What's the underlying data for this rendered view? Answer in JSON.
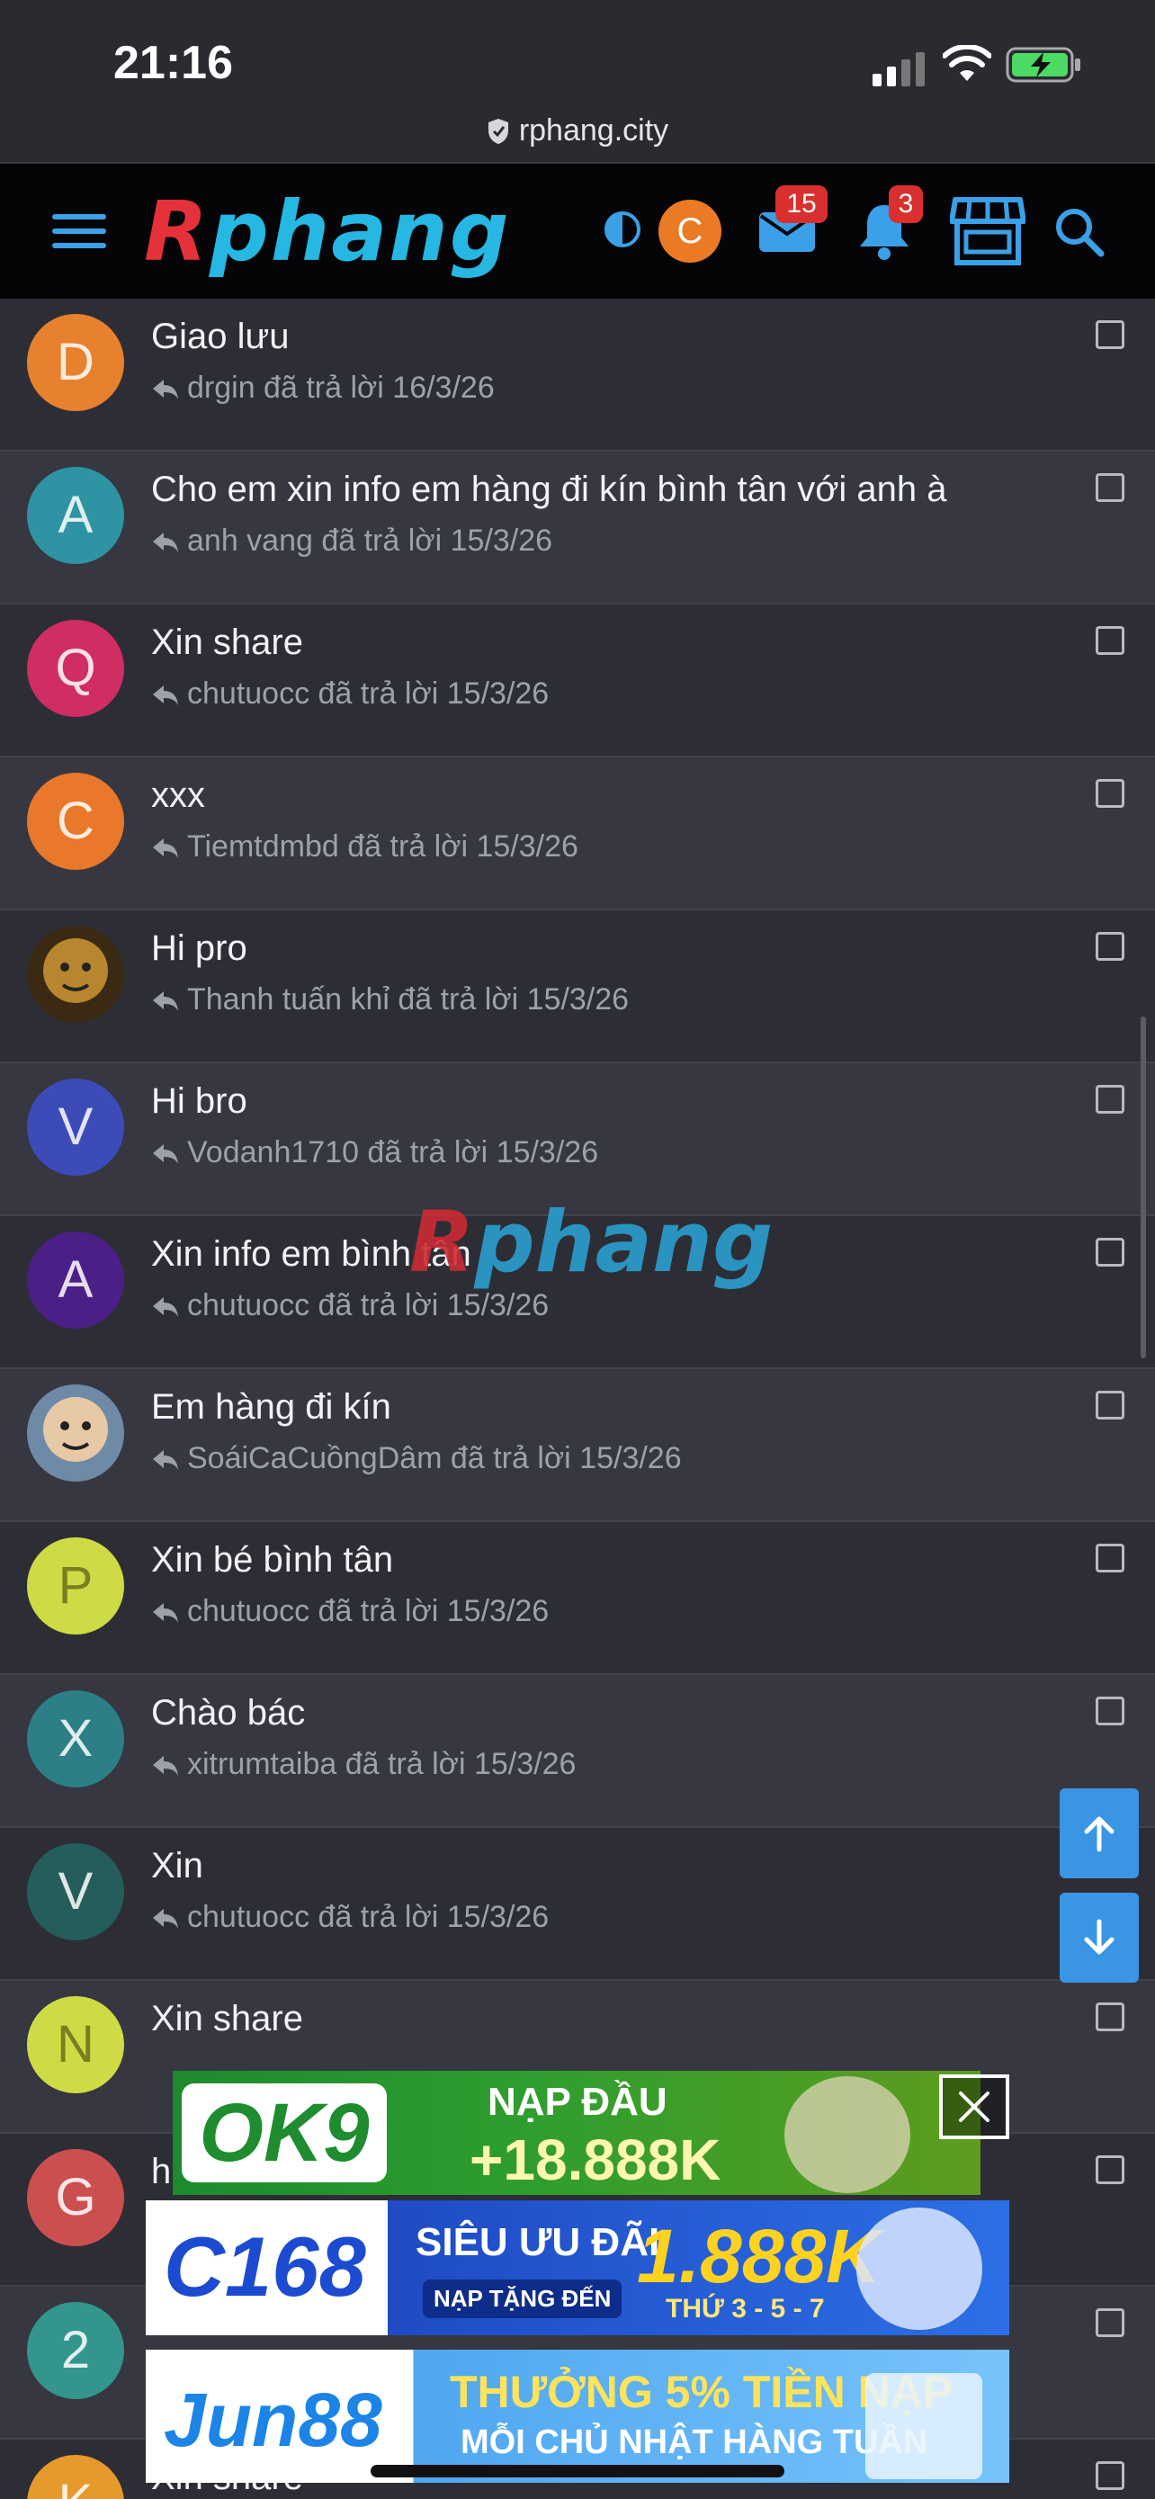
{
  "status_bar": {
    "time": "21:16"
  },
  "browser": {
    "url": "rphang.city"
  },
  "header": {
    "logo_r": "R",
    "logo_rest": "phang",
    "user_initial": "C",
    "mail_count": "15",
    "notification_count": "3"
  },
  "threads": [
    {
      "initial": "D",
      "avatar_color": "#e8812e",
      "title": "Giao lưu",
      "meta": "drgin đã trả lời 16/3/26"
    },
    {
      "initial": "A",
      "avatar_color": "#2e93a2",
      "title": "Cho em xin info em hàng đi kín bình tân với anh à",
      "meta": "anh vang đã trả lời 15/3/26"
    },
    {
      "initial": "Q",
      "avatar_color": "#cf2d63",
      "title": "Xin share",
      "meta": "chutuocc đã trả lời 15/3/26"
    },
    {
      "initial": "C",
      "avatar_color": "#e9782a",
      "title": "xxx",
      "meta": "Tiemtdmbd đã trả lời 15/3/26"
    },
    {
      "initial": "",
      "avatar_color": "#3a2a14",
      "avatar_icon": "lion-avatar-image",
      "title": "Hi pro",
      "meta": "Thanh tuấn khỉ đã trả lời 15/3/26"
    },
    {
      "initial": "V",
      "avatar_color": "#3d4bb8",
      "title": "Hi bro",
      "meta": "Vodanh1710 đã trả lời 15/3/26"
    },
    {
      "initial": "A",
      "avatar_color": "#4a1f86",
      "title": "Xin info em bình tân",
      "meta": "chutuocc đã trả lời 15/3/26"
    },
    {
      "initial": "",
      "avatar_color": "#6f8aa6",
      "avatar_icon": "cartoon-avatar-image",
      "title": "Em hàng đi kín",
      "meta": "SoáiCaCuồngDâm đã trả lời 15/3/26"
    },
    {
      "initial": "P",
      "avatar_color": "#cfdb45",
      "title": "Xin bé bình tân",
      "meta": "chutuocc đã trả lời 15/3/26"
    },
    {
      "initial": "X",
      "avatar_color": "#2c7f86",
      "title": "Chào bác",
      "meta": "xitrumtaiba đã trả lời 15/3/26"
    },
    {
      "initial": "V",
      "avatar_color": "#245d5a",
      "title": "Xin",
      "meta": "chutuocc đã trả lời 15/3/26"
    },
    {
      "initial": "N",
      "avatar_color": "#cfdb45",
      "title": "Xin share",
      "meta": ""
    },
    {
      "initial": "G",
      "avatar_color": "#cc4f4f",
      "title": "h",
      "meta": ""
    },
    {
      "initial": "2",
      "avatar_color": "#33958c",
      "title": "",
      "meta": ""
    },
    {
      "initial": "K",
      "avatar_color": "#e69a2c",
      "title": "Xin share",
      "meta": ""
    }
  ],
  "watermark": {
    "r": "R",
    "rest": "phang"
  },
  "ads": {
    "ok9": {
      "logo": "OK9",
      "line1": "NẠP ĐẦU",
      "line2": "+18.888K"
    },
    "c168": {
      "logo": "C168",
      "line1": "SIÊU ƯU ĐÃI",
      "line2": "NẠP TẶNG ĐẾN",
      "amount": "1.888K",
      "days": "THỨ 3 - 5 - 7"
    },
    "jun88": {
      "logo": "Jun88",
      "line1": "THƯỞNG 5% TIỀN NẠP",
      "line2": "MỖI CHỦ NHẬT HÀNG TUẦN"
    }
  }
}
